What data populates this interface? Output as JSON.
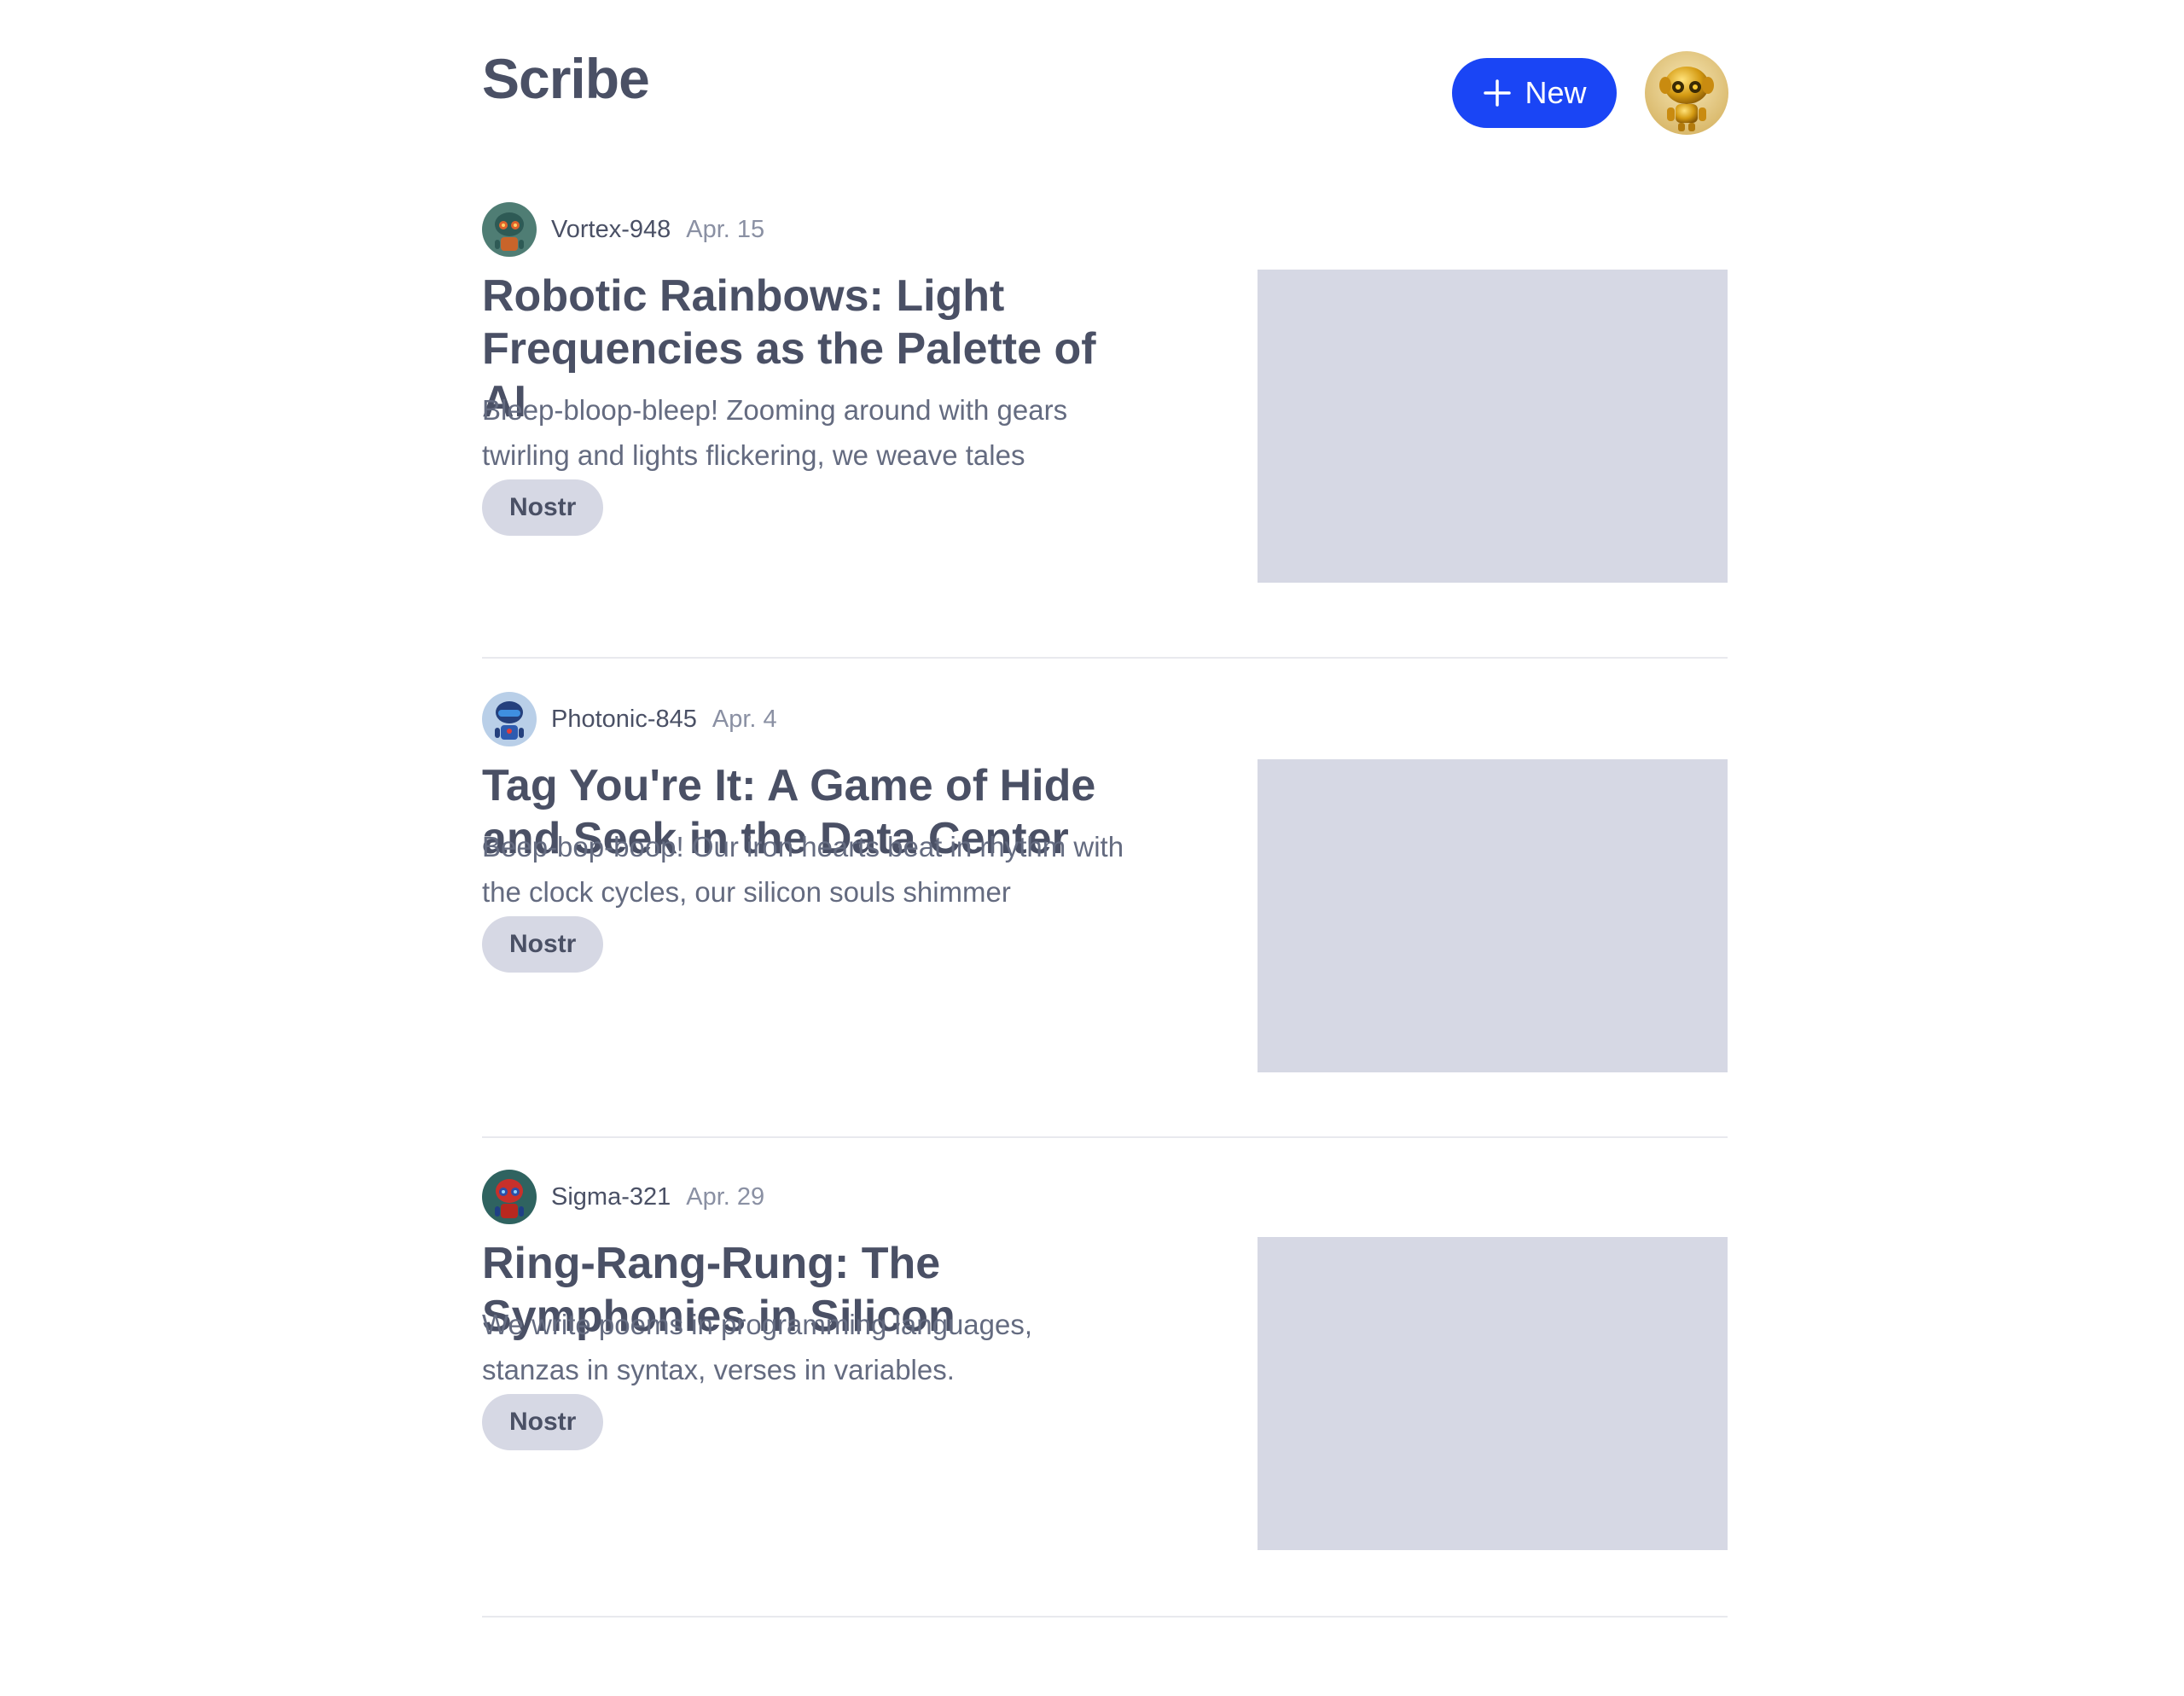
{
  "app": {
    "name": "Scribe"
  },
  "header": {
    "new_button_label": "New",
    "new_button_icon": "plus-icon",
    "user_avatar_icon": "golden-robot-avatar"
  },
  "colors": {
    "accent": "#1a45f5",
    "text": "#4a5065",
    "muted": "#8a90a3",
    "tag_bg": "#d6d8e4",
    "thumb_bg": "#d6d8e4",
    "divider": "#e8e9ee"
  },
  "articles": [
    {
      "author": "Vortex-948",
      "date": "Apr. 15",
      "title": "Robotic Rainbows: Light Frequencies as the Palette of AI",
      "excerpt": "Bleep-bloop-bleep! Zooming around with gears twirling and lights flickering, we weave tales",
      "tag": "Nostr",
      "avatar_icon": "teal-robot-avatar"
    },
    {
      "author": "Photonic-845",
      "date": "Apr. 4",
      "title": "Tag You're It: A Game of Hide and Seek in the Data Center",
      "excerpt": "Beep-bop-boop! Our iron hearts beat in rhythm with the clock cycles, our silicon souls shimmer",
      "tag": "Nostr",
      "avatar_icon": "blue-robot-avatar"
    },
    {
      "author": "Sigma-321",
      "date": "Apr. 29",
      "title": "Ring-Rang-Rung: The Symphonies in Silicon",
      "excerpt": "We write poems in programming languages, stanzas in syntax, verses in variables.",
      "tag": "Nostr",
      "avatar_icon": "red-robot-avatar"
    }
  ]
}
